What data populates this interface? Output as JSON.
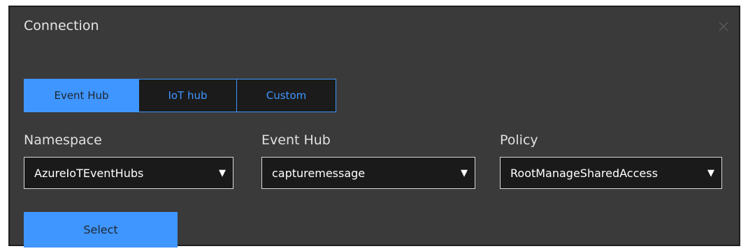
{
  "dialog": {
    "title": "Connection",
    "close_icon": "close-icon"
  },
  "tabs": [
    {
      "label": "Event Hub",
      "active": true
    },
    {
      "label": "IoT hub",
      "active": false
    },
    {
      "label": "Custom",
      "active": false
    }
  ],
  "fields": {
    "namespace": {
      "label": "Namespace",
      "value": "AzureIoTEventHubs"
    },
    "event_hub": {
      "label": "Event Hub",
      "value": "capturemessage"
    },
    "policy": {
      "label": "Policy",
      "value": "RootManageSharedAccess"
    }
  },
  "dropdown_arrow": "▼",
  "select_button_label": "Select",
  "colors": {
    "accent": "#4096ff",
    "dialog_bg": "#3a3a3a",
    "input_bg": "#1a1a1a"
  }
}
